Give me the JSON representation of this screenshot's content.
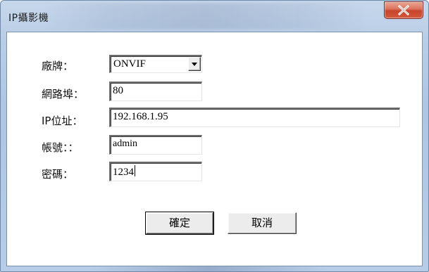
{
  "window": {
    "title": "IP攝影機",
    "close_icon": "close-x-icon"
  },
  "form": {
    "brand": {
      "label": "廠牌：",
      "selected": "ONVIF",
      "icon": "chevron-down-icon"
    },
    "port": {
      "label": "網路埠：",
      "value": "80"
    },
    "ip": {
      "label": "IP位址：",
      "value": "192.168.1.95"
    },
    "account": {
      "label": "帳號：：",
      "value": "admin"
    },
    "password": {
      "label": "密碼：",
      "value": "1234"
    }
  },
  "buttons": {
    "ok_label": "確定",
    "cancel_label": "取消"
  },
  "colors": {
    "frame": "#b9cde6",
    "close_button": "#c8432b",
    "client_background": "#ffffff"
  }
}
